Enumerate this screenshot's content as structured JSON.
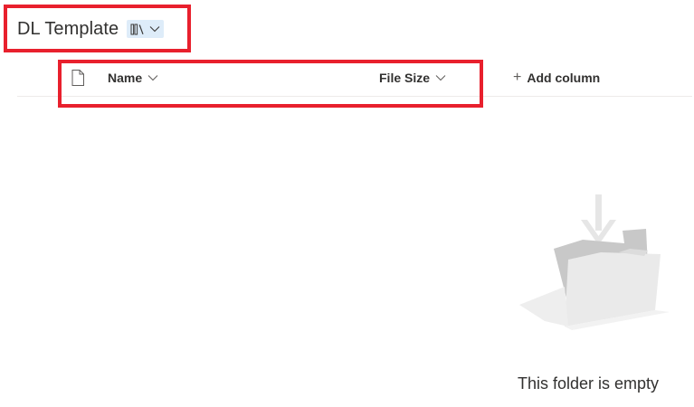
{
  "library": {
    "title": "DL Template",
    "view_switcher_icon": "library-books-icon"
  },
  "columns": {
    "file_type_icon": "document-icon",
    "name_label": "Name",
    "file_size_label": "File Size",
    "add_column_label": "Add column",
    "add_column_icon": "plus-icon"
  },
  "empty_state": {
    "message": "This folder is empty",
    "illustration": "empty-folder-icon"
  },
  "colors": {
    "highlight": "#e8202d",
    "view_switch_bg": "#deecf9",
    "text": "#323130"
  }
}
